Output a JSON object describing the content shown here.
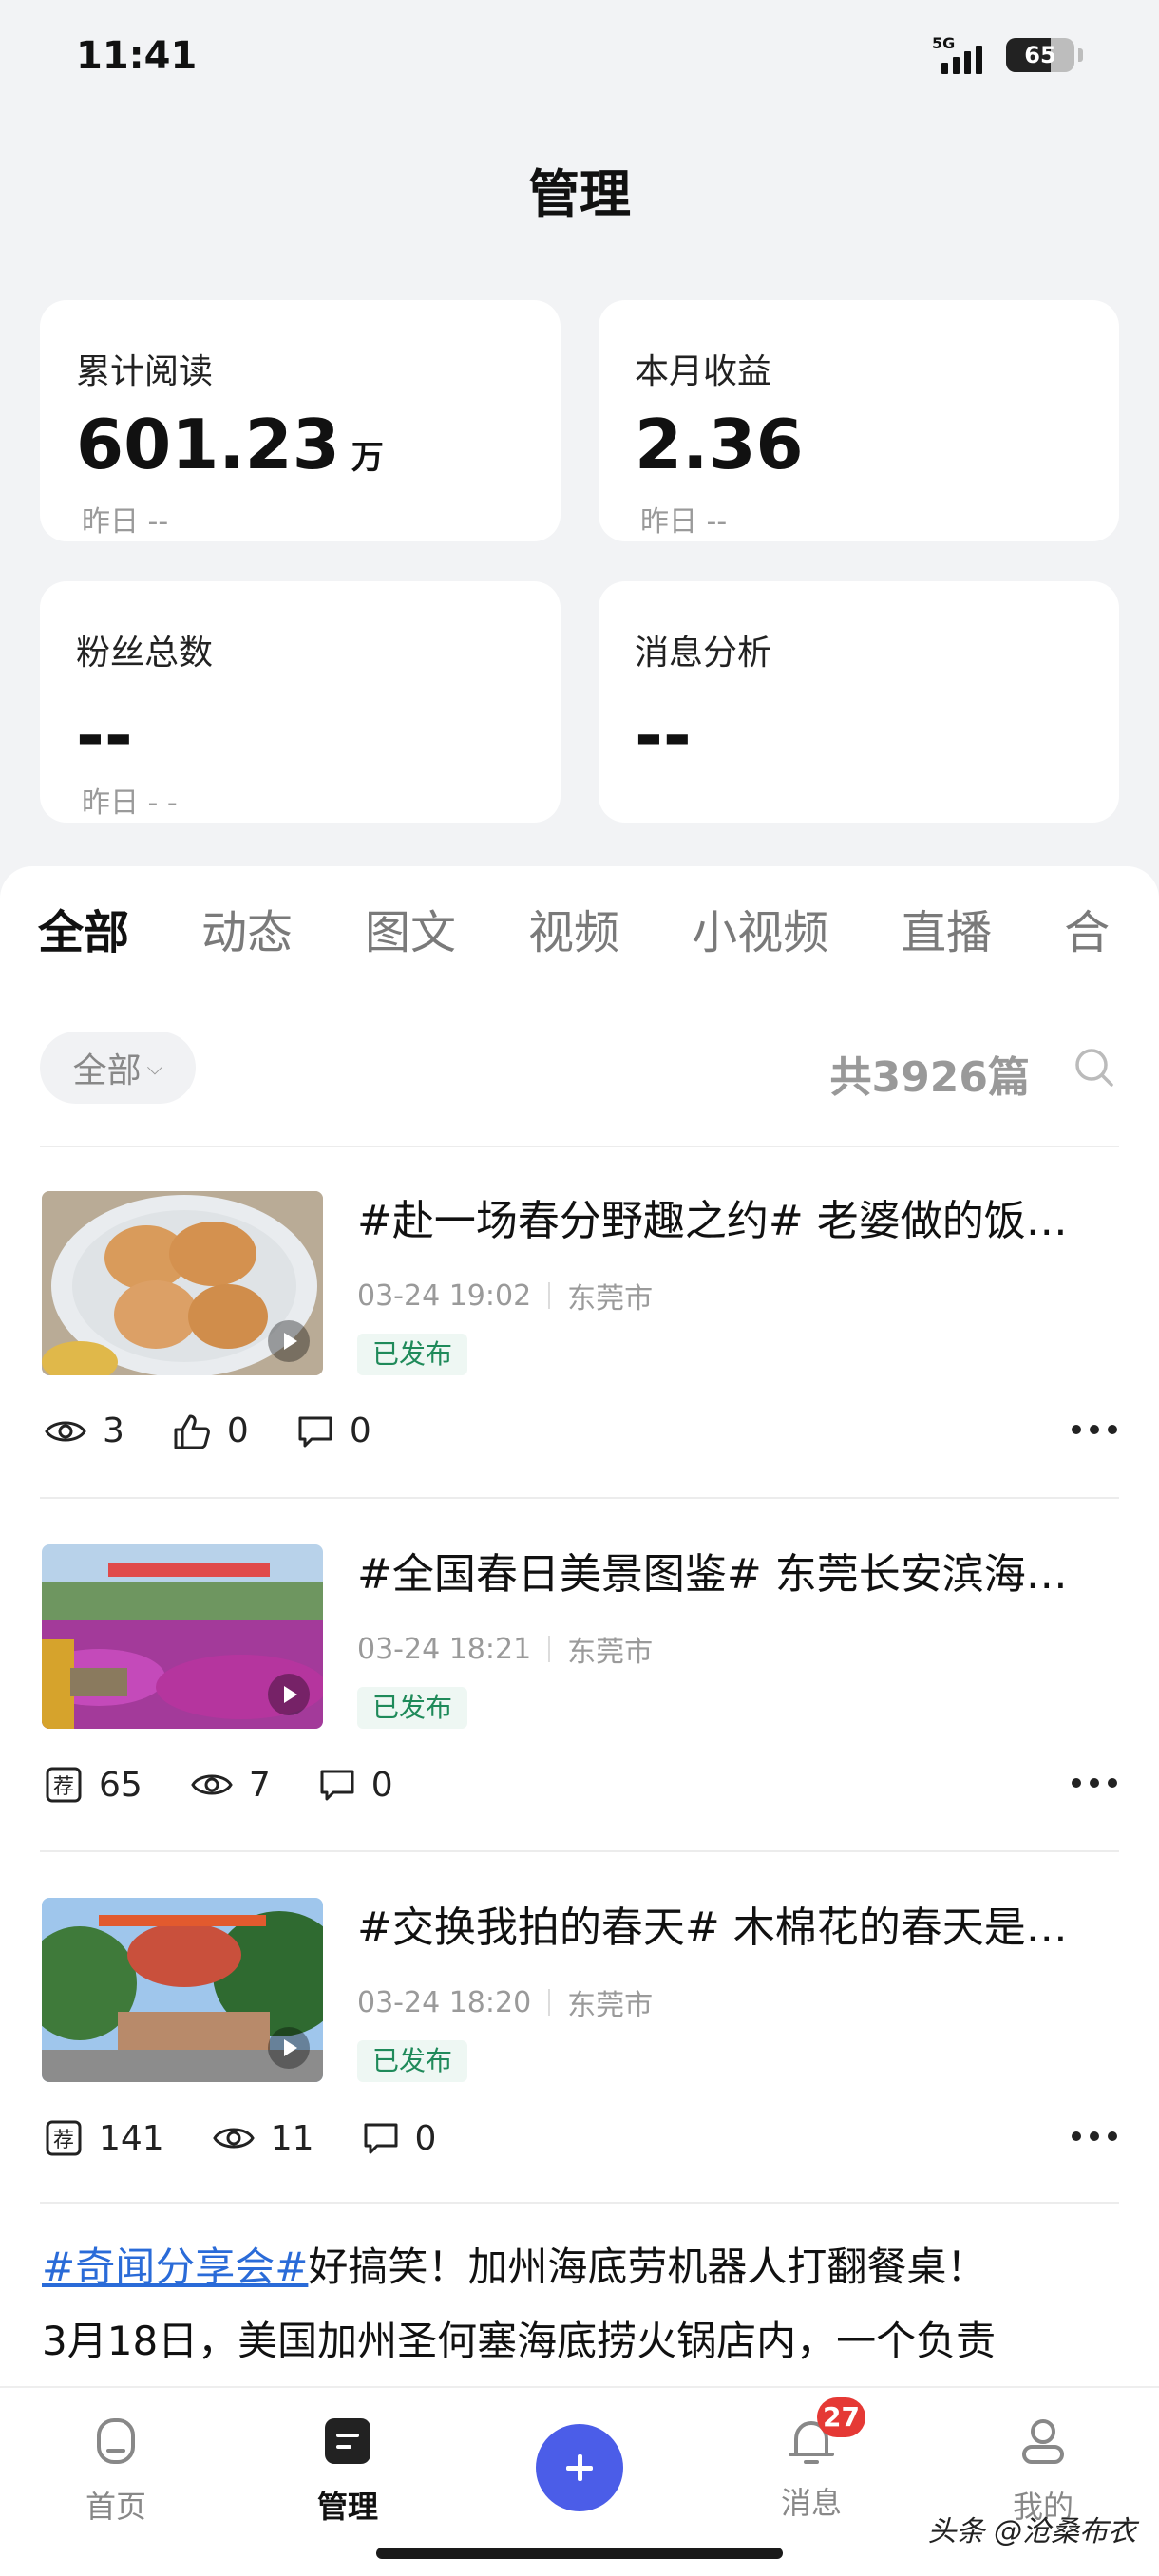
{
  "status_bar": {
    "time": "11:41",
    "network": "5G",
    "battery": "65"
  },
  "page_title": "管理",
  "cards": [
    {
      "label": "累计阅读",
      "value": "601.23",
      "unit": "万",
      "sub": "昨日 --"
    },
    {
      "label": "本月收益",
      "value": "2.36",
      "unit": "",
      "sub": "昨日 --"
    },
    {
      "label": "粉丝总数",
      "value": "--",
      "unit": "",
      "sub": "昨日 - -"
    },
    {
      "label": "消息分析",
      "value": "--",
      "unit": "",
      "sub": ""
    }
  ],
  "tabs": [
    "全部",
    "动态",
    "图文",
    "视频",
    "小视频",
    "直播",
    "合"
  ],
  "filter": {
    "label": "全部",
    "total": "共3926篇"
  },
  "items": [
    {
      "title": "#赴一场春分野趣之约# 老婆做的饭…",
      "date": "03-24 19:02",
      "location": "东莞市",
      "status": "已发布",
      "stats": [
        {
          "icon": "eye-icon",
          "value": "3"
        },
        {
          "icon": "thumb-up-icon",
          "value": "0"
        },
        {
          "icon": "comment-icon",
          "value": "0"
        }
      ]
    },
    {
      "title": "#全国春日美景图鉴# 东莞长安滨海…",
      "date": "03-24 18:21",
      "location": "东莞市",
      "status": "已发布",
      "stats": [
        {
          "icon": "recommend-icon",
          "value": "65"
        },
        {
          "icon": "eye-icon",
          "value": "7"
        },
        {
          "icon": "comment-icon",
          "value": "0"
        }
      ]
    },
    {
      "title": "#交换我拍的春天# 木棉花的春天是…",
      "date": "03-24 18:20",
      "location": "东莞市",
      "status": "已发布",
      "stats": [
        {
          "icon": "recommend-icon",
          "value": "141"
        },
        {
          "icon": "eye-icon",
          "value": "11"
        },
        {
          "icon": "comment-icon",
          "value": "0"
        }
      ]
    }
  ],
  "post": {
    "tag": "#奇闻分享会#",
    "line1": "好搞笑！加州海底劳机器人打翻餐桌！",
    "line2": "3月18日，美国加州圣何塞海底捞火锅店内，一个负责"
  },
  "bottom_nav": [
    {
      "label": "首页",
      "icon": "home-icon"
    },
    {
      "label": "管理",
      "icon": "manage-icon"
    },
    {
      "label": "",
      "icon": "add-icon"
    },
    {
      "label": "消息",
      "icon": "bell-icon",
      "badge": "27"
    },
    {
      "label": "我的",
      "icon": "profile-icon"
    }
  ],
  "watermark": "头条 @沧桑布衣",
  "colors": {
    "accent": "#4b5de8",
    "published_green": "#1f8a5a",
    "link_blue": "#2a6bd8",
    "badge_red": "#e53935"
  }
}
